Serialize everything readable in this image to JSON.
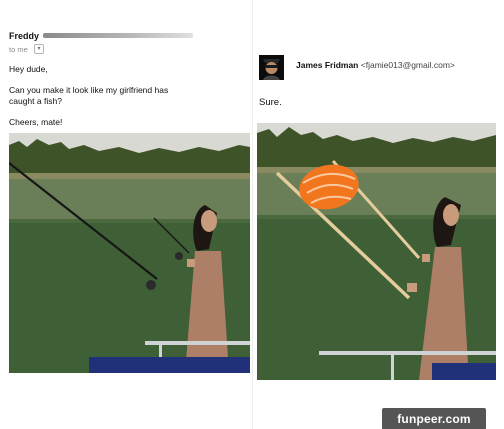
{
  "email": {
    "sender_name": "Freddy",
    "to_label": "to me",
    "caret": "▾",
    "greeting": "Hey dude,",
    "request_line1": "Can you make it look like my girlfriend has",
    "request_line2": "caught a fish?",
    "signoff": "Cheers, mate!"
  },
  "reply": {
    "name": "James Fridman",
    "email": "<fjamie013@gmail.com>",
    "text": "Sure."
  },
  "watermark": "funpeer.com",
  "colors": {
    "sky": "#dcdcd6",
    "water": "#4a6a3e",
    "trees": "#3e5228",
    "dress": "#b08066",
    "fish": "#f2761e",
    "rod": "#e8cfa0"
  }
}
